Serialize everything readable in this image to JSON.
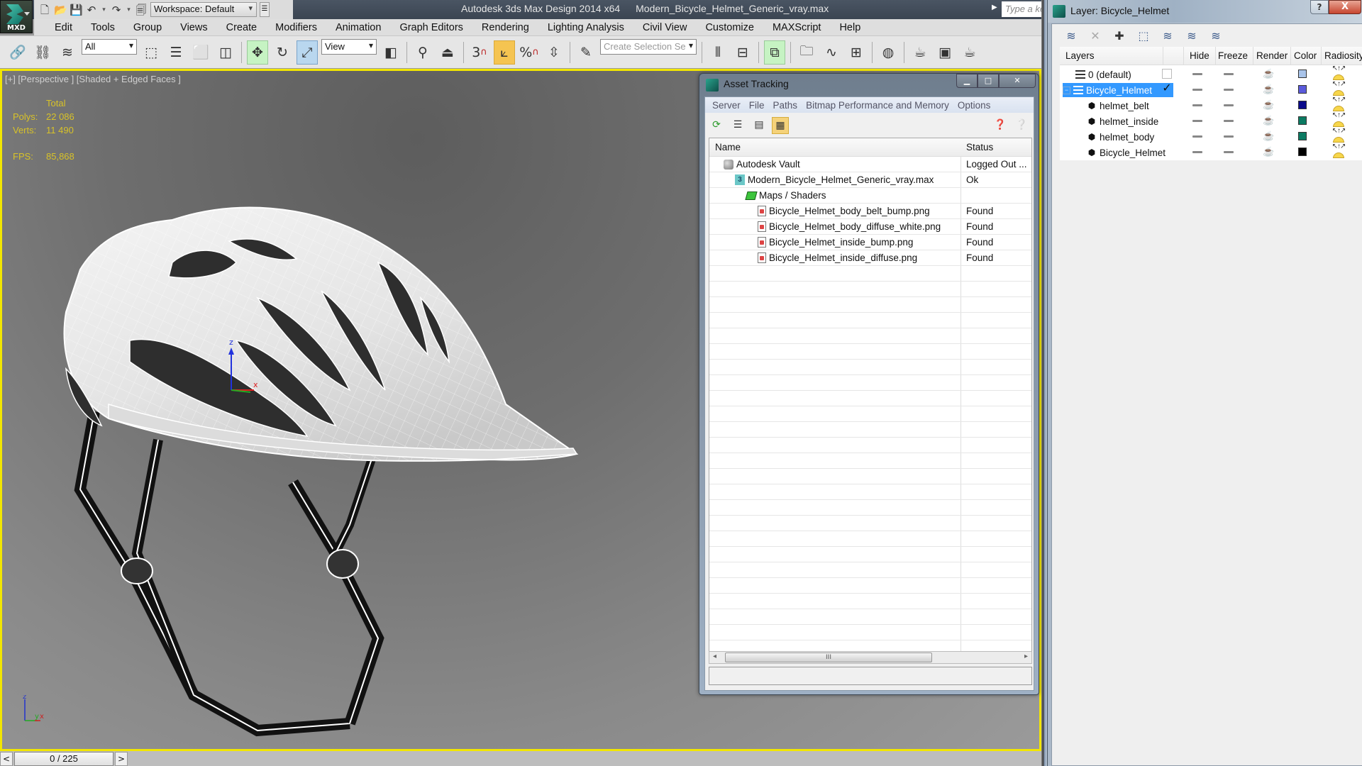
{
  "app": {
    "logo_label": "MXD",
    "title": "Autodesk 3ds Max Design 2014 x64",
    "filename": "Modern_Bicycle_Helmet_Generic_vray.max",
    "workspace": "Workspace: Default",
    "search_placeholder": "Type a keyword or phrase"
  },
  "menu": [
    "Edit",
    "Tools",
    "Group",
    "Views",
    "Create",
    "Modifiers",
    "Animation",
    "Graph Editors",
    "Rendering",
    "Lighting Analysis",
    "Civil View",
    "Customize",
    "MAXScript",
    "Help"
  ],
  "toolbar": {
    "selection_filter": "All",
    "ref_coord_system": "View",
    "named_selection_placeholder": "Create Selection Se",
    "snap_label": "3",
    "percent_snap_label": "%"
  },
  "viewport": {
    "label": "[+] [Perspective ] [Shaded + Edged Faces ]",
    "stats_header": "Total",
    "polys_label": "Polys:",
    "polys_value": "22 086",
    "verts_label": "Verts:",
    "verts_value": "11 490",
    "fps_label": "FPS:",
    "fps_value": "85,868",
    "axis": {
      "z": "z",
      "y": "y",
      "x": "x"
    },
    "gizmo": {
      "z": "z",
      "x": "x"
    }
  },
  "timeline": {
    "prev": "<",
    "position": "0 / 225",
    "next": ">"
  },
  "asset_tracking": {
    "title": "Asset Tracking",
    "menu": [
      "Server",
      "File",
      "Paths",
      "Bitmap Performance and Memory",
      "Options"
    ],
    "columns": {
      "name": "Name",
      "status": "Status"
    },
    "rows": [
      {
        "name": "Autodesk Vault",
        "status": "Logged Out ...",
        "icon": "vault-icon",
        "indent": 1
      },
      {
        "name": "Modern_Bicycle_Helmet_Generic_vray.max",
        "status": "Ok",
        "icon": "max-file-icon",
        "indent": 2
      },
      {
        "name": "Maps / Shaders",
        "status": "",
        "icon": "maps-icon",
        "indent": 3
      },
      {
        "name": "Bicycle_Helmet_body_belt_bump.png",
        "status": "Found",
        "icon": "png-file-icon",
        "indent": 4
      },
      {
        "name": "Bicycle_Helmet_body_diffuse_white.png",
        "status": "Found",
        "icon": "png-file-icon",
        "indent": 4
      },
      {
        "name": "Bicycle_Helmet_inside_bump.png",
        "status": "Found",
        "icon": "png-file-icon",
        "indent": 4
      },
      {
        "name": "Bicycle_Helmet_inside_diffuse.png",
        "status": "Found",
        "icon": "png-file-icon",
        "indent": 4
      }
    ],
    "scroll_thumb_grip": "III"
  },
  "layer_dialog": {
    "title": "Layer: Bicycle_Helmet",
    "help": "?",
    "close": "X",
    "columns": {
      "layers": "Layers",
      "hide": "Hide",
      "freeze": "Freeze",
      "render": "Render",
      "color": "Color",
      "radiosity": "Radiosity"
    },
    "rows": [
      {
        "name": "0 (default)",
        "type": "layer",
        "current": false,
        "selected": false,
        "color": "#a9c4ea",
        "indent": 1
      },
      {
        "name": "Bicycle_Helmet",
        "type": "layer",
        "current": true,
        "selected": true,
        "expanded": true,
        "color": "#5b5bdc",
        "indent": 0
      },
      {
        "name": "helmet_belt",
        "type": "object",
        "color": "#0a0a8a",
        "indent": 2
      },
      {
        "name": "helmet_inside",
        "type": "object",
        "color": "#0b7a62",
        "indent": 2
      },
      {
        "name": "helmet_body",
        "type": "object",
        "color": "#0b7a62",
        "indent": 2
      },
      {
        "name": "Bicycle_Helmet",
        "type": "object",
        "color": "#000000",
        "indent": 2
      }
    ]
  },
  "colors": {
    "viewport_border": "#f2e600",
    "stats_text": "#d8c228",
    "selection_blue": "#3399ff"
  }
}
